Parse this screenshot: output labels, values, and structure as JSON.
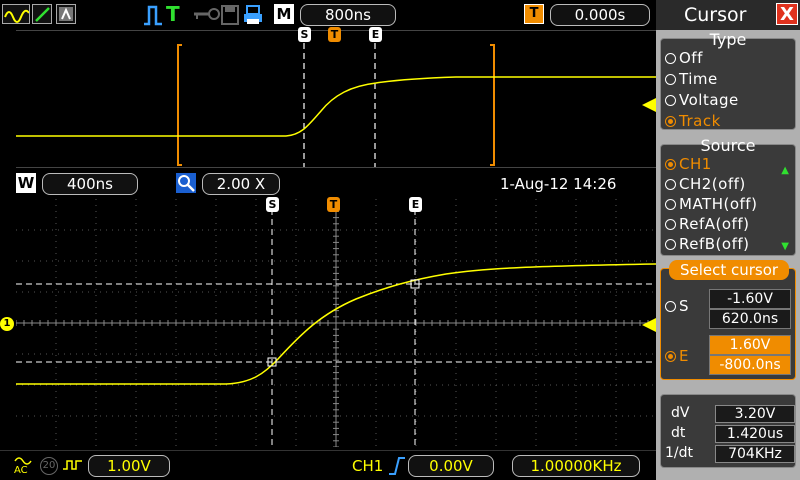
{
  "top": {
    "timebase": "800ns",
    "trigger_delay": "0.000s",
    "m_label": "M",
    "t_label": "T"
  },
  "mid": {
    "w_label": "W",
    "window_timebase": "400ns",
    "zoom": "2.00 X",
    "datetime": "1-Aug-12 14:26"
  },
  "cursor_markers": {
    "s": "S",
    "e": "E",
    "t": "T"
  },
  "channel_marker": "1",
  "bottom": {
    "coupling": "AC",
    "bw_label": "20",
    "volts_div": "1.00V",
    "trigger_source": "CH1",
    "trigger_level": "0.00V",
    "frequency": "1.00000KHz"
  },
  "panel": {
    "title": "Cursor",
    "close": "X",
    "type_title": "Type",
    "type_options": [
      "Off",
      "Time",
      "Voltage",
      "Track"
    ],
    "type_selected": "Track",
    "source_title": "Source",
    "source_options": [
      "CH1",
      "CH2(off)",
      "MATH(off)",
      "RefA(off)",
      "RefB(off)"
    ],
    "source_selected": "CH1",
    "select_title": "Select cursor",
    "s_label": "S",
    "s_volt": "-1.60V",
    "s_time": "620.0ns",
    "e_label": "E",
    "e_volt": "1.60V",
    "e_time": "-800.0ns",
    "dv_label": "dV",
    "dv_value": "3.20V",
    "dt_label": "dt",
    "dt_value": "1.420us",
    "inv_dt_label": "1/dt",
    "inv_dt_value": "704KHz"
  },
  "colors": {
    "trace": "#ffff00",
    "accent": "#f08c00",
    "panel_bg": "#b0b0b0"
  }
}
